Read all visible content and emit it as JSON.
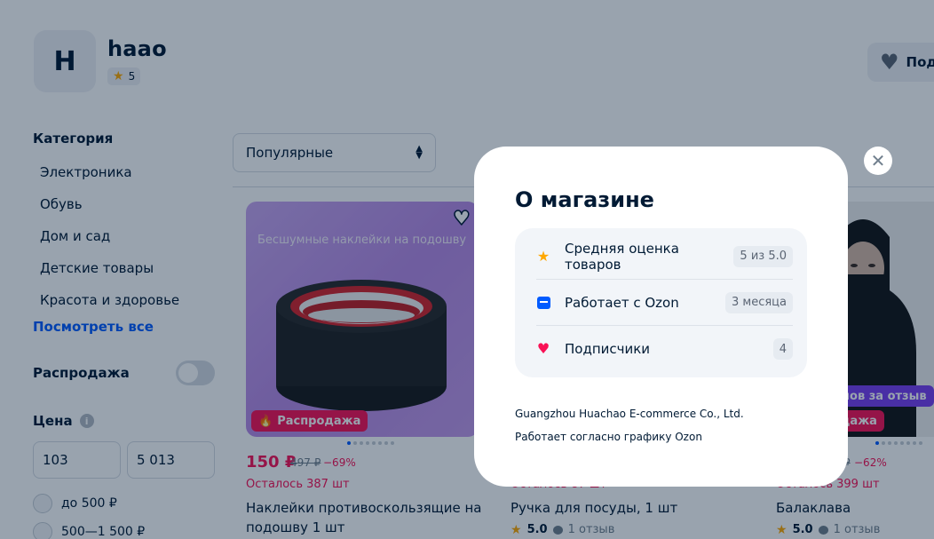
{
  "shop": {
    "logo_letter": "H",
    "name": "haao",
    "rating": "5",
    "subscribe_label": "Под"
  },
  "sidebar": {
    "category_title": "Категория",
    "categories": [
      "Электроника",
      "Обувь",
      "Дом и сад",
      "Детские товары",
      "Красота и здоровье"
    ],
    "see_all": "Посмотреть все",
    "sale_label": "Распродажа",
    "sale_enabled": false,
    "price_label": "Цена",
    "price_from": "103",
    "price_to": "5 013",
    "price_ranges": [
      "до 500 ₽",
      "500—1 500 ₽"
    ]
  },
  "sort": {
    "value": "Популярные"
  },
  "products": [
    {
      "image_caption": "Бесшумные наклейки на подошву",
      "badge": "Распродажа",
      "price": "150 ₽",
      "old_price": "497 ₽",
      "discount": "−69%",
      "stock": "Осталось 387 шт",
      "title_line1": "Наклейки противоскользящие на",
      "title_line2": "подошву 1 шт"
    },
    {
      "stock": "Осталось 87 шт",
      "title_line1": "Ручка для посуды, 1 шт",
      "rating": "5.0",
      "reviews": "1 отзыв"
    },
    {
      "review_badge": "ллов за отзыв",
      "badge": "одажа",
      "old_price": "₽",
      "discount": "−62%",
      "stock": "Осталось 399 шт",
      "title_line1": "Балаклава",
      "rating": "5.0",
      "reviews": "1 отзыв"
    }
  ],
  "modal": {
    "title": "О магазине",
    "stats": [
      {
        "icon": "star-icon",
        "label": "Средняя оценка товаров",
        "value": "5 из 5.0",
        "color": "#ffa800"
      },
      {
        "icon": "calendar-icon",
        "label": "Работает с Ozon",
        "value": "3 месяца",
        "color": "#005bff"
      },
      {
        "icon": "heart-icon",
        "label": "Подписчики",
        "value": "4",
        "color": "#f91155"
      }
    ],
    "company": "Guangzhou Huachao E-commerce Co., Ltd.",
    "schedule": "Работает согласно графику Ozon",
    "close_icon": "close-icon"
  },
  "colors": {
    "accent": "#005bff",
    "sale": "#f91155",
    "star": "#ffa800",
    "overlay": "rgba(0,26,52,0.4)"
  }
}
